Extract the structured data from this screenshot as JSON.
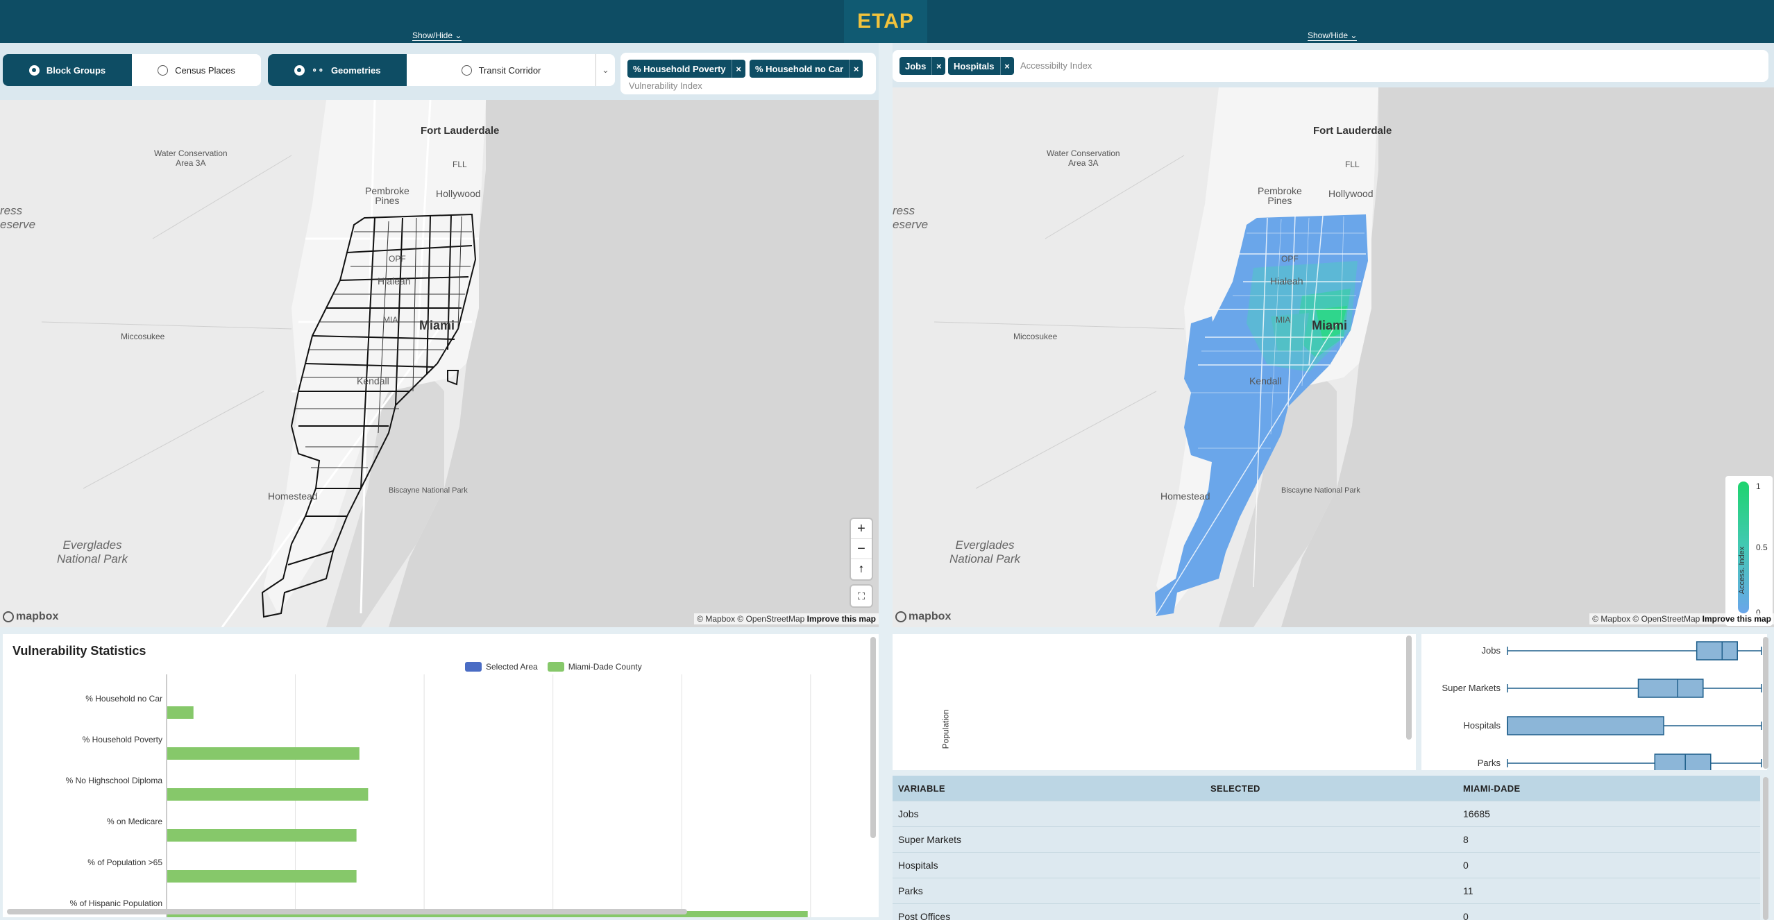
{
  "app": {
    "title": "ETAP",
    "show_hide_left": "Show/Hide ⌄",
    "show_hide_right": "Show/Hide ⌄"
  },
  "controls": {
    "geo_options": [
      {
        "label": "Block Groups",
        "selected": true
      },
      {
        "label": "Census Places",
        "selected": false
      }
    ],
    "mode_options": [
      {
        "label": "Geometries",
        "selected": true
      },
      {
        "label": "Transit Corridor",
        "selected": false
      }
    ],
    "chevron": "⌄",
    "vulnerability": {
      "chips": [
        "% Household Poverty",
        "% Household no Car"
      ],
      "placeholder": "Vulnerability Index",
      "remove": "×"
    },
    "accessibility": {
      "chips": [
        "Jobs",
        "Hospitals"
      ],
      "placeholder": "Accessibilty Index",
      "remove": "×"
    }
  },
  "maps": {
    "labels": {
      "fort_lauderdale": "Fort Lauderdale",
      "fll": "FLL",
      "water_conservation": "Water Conservation\nArea 3A",
      "pembroke_pines": "Pembroke\nPines",
      "hollywood": "Hollywood",
      "hialeah": "Hialeah",
      "miccosukee": "Miccosukee",
      "miami": "Miami",
      "mia": "MIA",
      "kendall": "Kendall",
      "homestead": "Homestead",
      "biscayne": "Biscayne National Park",
      "everglades": "Everglades\nNational Park",
      "reserve": "ress\neserve",
      "opf": "OPF"
    },
    "attribution": "© Mapbox © OpenStreetMap",
    "improve": "Improve this map",
    "mapbox_logo": "mapbox",
    "zoom_in": "+",
    "zoom_out": "−",
    "compass": "⭡",
    "fullscreen": "⛶",
    "legend": {
      "title": "Access. Index",
      "ticks": [
        "1",
        "0.5",
        "0"
      ]
    },
    "colors": {
      "low": "#6aa6ea",
      "mid": "#44c8b5",
      "high": "#1ed46e"
    }
  },
  "vulnerability_stats": {
    "title": "Vulnerability Statistics",
    "legend": [
      {
        "name": "Selected Area",
        "color": "#4a6cc4"
      },
      {
        "name": "Miami-Dade County",
        "color": "#86c86a"
      }
    ]
  },
  "chart_data": {
    "type": "bar",
    "orientation": "horizontal",
    "title": "Vulnerability Statistics",
    "categories": [
      "% Household no Car",
      "% Household Poverty",
      "% No Highschool Diploma",
      "% on Medicare",
      "% of Population >65",
      "% of Hispanic Population"
    ],
    "series": [
      {
        "name": "Selected Area",
        "color": "#4a6cc4",
        "values": [
          0,
          0,
          0,
          0,
          0,
          0
        ]
      },
      {
        "name": "Miami-Dade County",
        "color": "#86c86a",
        "values": [
          9,
          66,
          69,
          65,
          65,
          220
        ]
      }
    ],
    "xlim": [
      0,
      220
    ],
    "grid": true
  },
  "population_panel": {
    "ylabel": "Population"
  },
  "boxplots": {
    "rows": [
      {
        "label": "Jobs",
        "min": 0.0,
        "q1": 0.745,
        "median": 0.845,
        "q3": 0.905,
        "max": 1.0
      },
      {
        "label": "Super Markets",
        "min": 0.0,
        "q1": 0.515,
        "median": 0.67,
        "q3": 0.77,
        "max": 1.0
      },
      {
        "label": "Hospitals",
        "min": 0.0,
        "q1": 0.0,
        "median": 0.0,
        "q3": 0.615,
        "max": 1.0
      },
      {
        "label": "Parks",
        "min": 0.0,
        "q1": 0.58,
        "median": 0.7,
        "q3": 0.8,
        "max": 1.0
      }
    ]
  },
  "table": {
    "headers": [
      "VARIABLE",
      "SELECTED",
      "MIAMI-DADE"
    ],
    "rows": [
      [
        "Jobs",
        "",
        "16685"
      ],
      [
        "Super Markets",
        "",
        "8"
      ],
      [
        "Hospitals",
        "",
        "0"
      ],
      [
        "Parks",
        "",
        "11"
      ],
      [
        "Post Offices",
        "",
        "0"
      ]
    ]
  }
}
